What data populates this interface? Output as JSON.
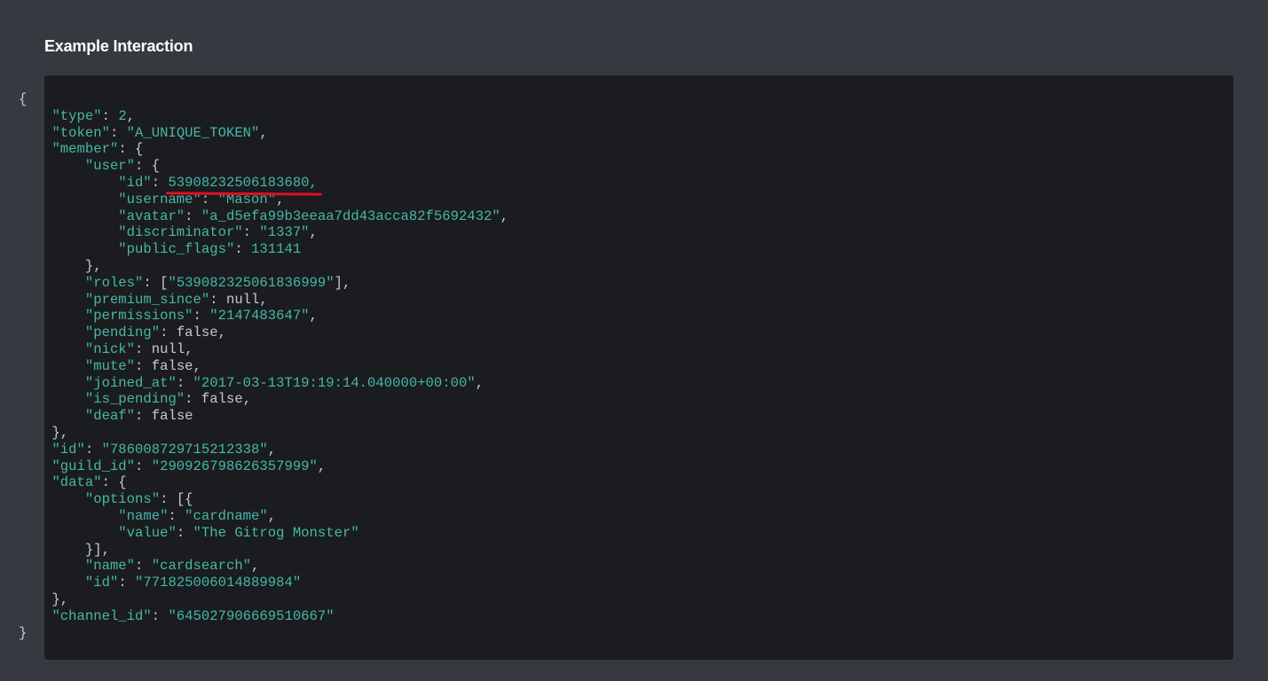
{
  "section": {
    "title": "Example Interaction"
  },
  "code": {
    "open_brace": "{",
    "type_key": "\"type\"",
    "type_value": "2",
    "token_key": "\"token\"",
    "token_value": "\"A_UNIQUE_TOKEN\"",
    "member_key": "\"member\"",
    "user_key": "\"user\"",
    "user_id_key": "\"id\"",
    "user_id_value": "53908232506183680,",
    "username_key": "\"username\"",
    "username_value": "\"Mason\"",
    "avatar_key": "\"avatar\"",
    "avatar_value": "\"a_d5efa99b3eeaa7dd43acca82f5692432\"",
    "discriminator_key": "\"discriminator\"",
    "discriminator_value": "\"1337\"",
    "public_flags_key": "\"public_flags\"",
    "public_flags_value": "131141",
    "roles_key": "\"roles\"",
    "roles_value": "\"539082325061836999\"",
    "premium_since_key": "\"premium_since\"",
    "premium_since_value": "null",
    "permissions_key": "\"permissions\"",
    "permissions_value": "\"2147483647\"",
    "pending_key": "\"pending\"",
    "pending_value": "false",
    "nick_key": "\"nick\"",
    "nick_value": "null",
    "mute_key": "\"mute\"",
    "mute_value": "false",
    "joined_at_key": "\"joined_at\"",
    "joined_at_value": "\"2017-03-13T19:19:14.040000+00:00\"",
    "is_pending_key": "\"is_pending\"",
    "is_pending_value": "false",
    "deaf_key": "\"deaf\"",
    "deaf_value": "false",
    "id_key": "\"id\"",
    "id_value": "\"786008729715212338\"",
    "guild_id_key": "\"guild_id\"",
    "guild_id_value": "\"290926798626357999\"",
    "data_key": "\"data\"",
    "options_key": "\"options\"",
    "option_name_key": "\"name\"",
    "option_name_value": "\"cardname\"",
    "option_value_key": "\"value\"",
    "option_value_value": "\"The Gitrog Monster\"",
    "data_name_key": "\"name\"",
    "data_name_value": "\"cardsearch\"",
    "data_id_key": "\"id\"",
    "data_id_value": "\"771825006014889984\"",
    "channel_id_key": "\"channel_id\"",
    "channel_id_value": "\"645027906669510667\"",
    "close_brace": "}"
  },
  "colors": {
    "page_background": "#363940",
    "code_background": "#1b1c20",
    "token_color": "#45b8a6",
    "punctuation_color": "#c7c9cc",
    "title_color": "#ffffff",
    "annotation_underline": "#e0101f"
  }
}
